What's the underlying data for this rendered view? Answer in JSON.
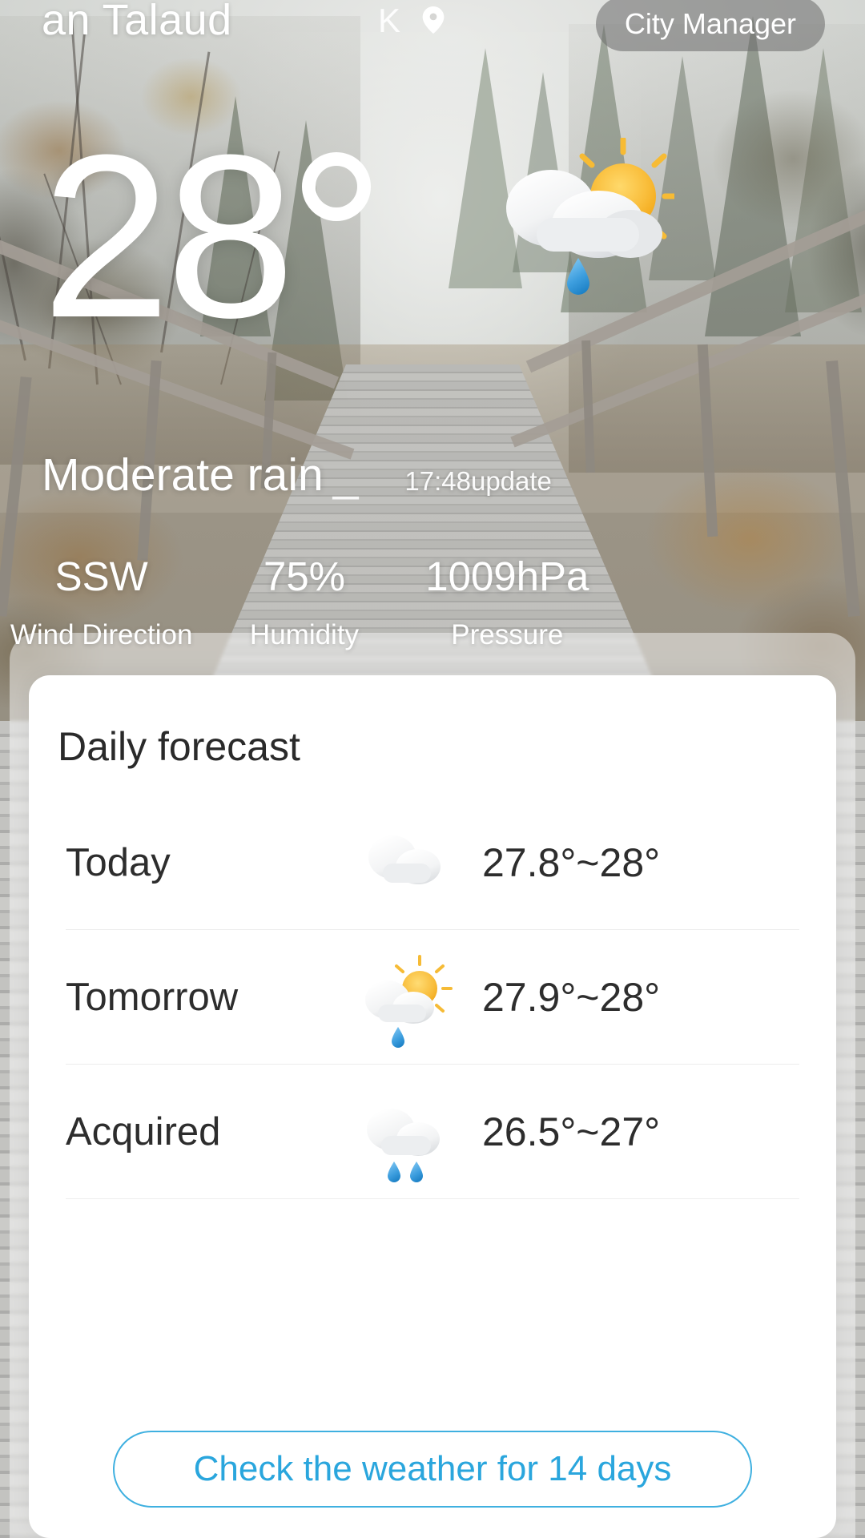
{
  "topbar": {
    "city_name": "an Talaud",
    "k_glyph": "K",
    "pin_icon": "location-pin-icon",
    "city_manager_label": "City Manager"
  },
  "hero": {
    "temperature": "28",
    "degree_symbol": "°",
    "condition": "Moderate rain",
    "condition_dash": "_",
    "update_time": "17:48update",
    "weather_icon": "sun-behind-cloud-with-rain-icon",
    "metrics": [
      {
        "value": "SSW",
        "label": "Wind Direction",
        "icon": "wind-direction-icon"
      },
      {
        "value": "75%",
        "label": "Humidity",
        "icon": "humidity-icon"
      },
      {
        "value": "1009hPa",
        "label": "Pressure",
        "icon": "pressure-icon"
      }
    ]
  },
  "forecast_card": {
    "title": "Daily forecast",
    "rows": [
      {
        "day": "Today",
        "icon": "cloud-icon",
        "temp_range": "27.8°~28°"
      },
      {
        "day": "Tomorrow",
        "icon": "sun-behind-cloud-rain-icon",
        "temp_range": "27.9°~28°"
      },
      {
        "day": "Acquired",
        "icon": "cloud-with-rain-icon",
        "temp_range": "26.5°~27°"
      }
    ],
    "cta_label": "Check the weather for 14 days"
  },
  "colors": {
    "cta_border": "#3fb0e0",
    "cta_text": "#2aa6dd",
    "card_bg": "#ffffff",
    "hero_text": "#ffffff",
    "pill_bg": "rgba(110,110,110,0.58)",
    "sun_yellow": "#f5b93c",
    "raindrop_blue": "#3a9bdc"
  }
}
